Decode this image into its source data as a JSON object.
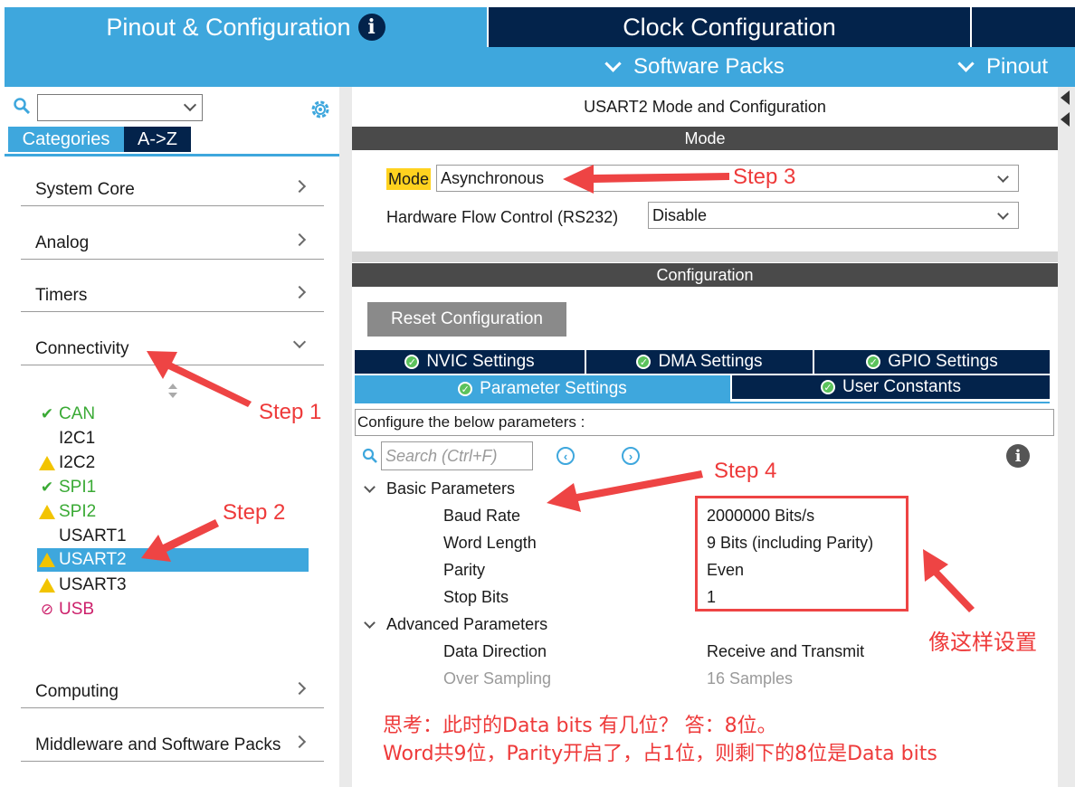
{
  "tabs": {
    "pinout": "Pinout & Configuration",
    "clock": "Clock Configuration"
  },
  "subbar": {
    "software_packs": "Software Packs",
    "pinout": "Pinout"
  },
  "left": {
    "categories_tab": "Categories",
    "az_tab": "A->Z",
    "categories": [
      "System Core",
      "Analog",
      "Timers",
      "Connectivity",
      "Computing",
      "Middleware and Software Packs"
    ],
    "peripherals": [
      {
        "name": "CAN",
        "status": "check"
      },
      {
        "name": "I2C1",
        "status": "none"
      },
      {
        "name": "I2C2",
        "status": "warning"
      },
      {
        "name": "SPI1",
        "status": "check"
      },
      {
        "name": "SPI2",
        "status": "warning"
      },
      {
        "name": "USART1",
        "status": "none"
      },
      {
        "name": "USART2",
        "status": "warning"
      },
      {
        "name": "USART3",
        "status": "warning"
      },
      {
        "name": "USB",
        "status": "disabled"
      }
    ]
  },
  "right": {
    "title": "USART2 Mode and Configuration",
    "mode_section": "Mode",
    "mode_label": "Mode",
    "mode_value": "Asynchronous",
    "flow_label": "Hardware Flow Control (RS232)",
    "flow_value": "Disable",
    "config_section": "Configuration",
    "reset_button": "Reset Configuration",
    "config_tabs": {
      "nvic": "NVIC Settings",
      "dma": "DMA Settings",
      "gpio": "GPIO Settings",
      "parameter": "Parameter Settings",
      "user_constants": "User Constants"
    },
    "configure_hint": "Configure the below parameters :",
    "search_placeholder": "Search (Ctrl+F)",
    "basic_group": "Basic Parameters",
    "basic_params": [
      {
        "name": "Baud Rate",
        "value": "2000000 Bits/s"
      },
      {
        "name": "Word Length",
        "value": "9 Bits (including Parity)"
      },
      {
        "name": "Parity",
        "value": "Even"
      },
      {
        "name": "Stop Bits",
        "value": "1"
      }
    ],
    "advanced_group": "Advanced Parameters",
    "advanced_params": [
      {
        "name": "Data Direction",
        "value": "Receive and Transmit"
      },
      {
        "name": "Over Sampling",
        "value": "16 Samples"
      }
    ]
  },
  "annotations": {
    "step1": "Step 1",
    "step2": "Step 2",
    "step3": "Step 3",
    "step4": "Step 4",
    "set_like_this": "像这样设置",
    "question": "思考：此时的Data bits 有几位？      答：8位。",
    "explanation": "Word共9位，Parity开启了，占1位，则剩下的8位是Data bits"
  },
  "colors": {
    "accent_blue": "#3ea7dd",
    "navy": "#03234b",
    "annotation_red": "#ee3a3a",
    "mode_highlight": "#ffd21f"
  }
}
